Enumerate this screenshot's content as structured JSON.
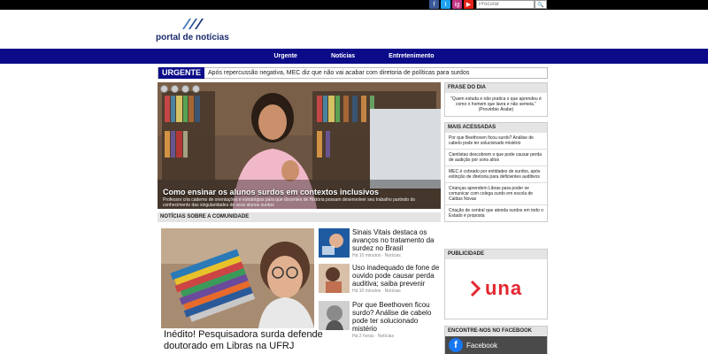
{
  "search": {
    "placeholder": "Procurar",
    "button_label": "🔍"
  },
  "social": [
    "f",
    "t",
    "ig",
    "▶"
  ],
  "brand": {
    "name": "portal de notícias"
  },
  "nav": {
    "items": [
      "Urgente",
      "Notícias",
      "Entretenimento"
    ]
  },
  "ticker": {
    "tag": "URGENTE",
    "text": "Após repercussão negativa, MEC diz que não vai acabar com diretoria de políticas para surdos"
  },
  "hero": {
    "title": "Como ensinar os alunos surdos em contextos inclusivos",
    "subtitle": "Professor cria caderno de orientações e estratégias para que docentes de História possam desenvolver seu trabalho partindo do conhecimento das singularidades de seus alunos surdos"
  },
  "community": {
    "heading": "NOTÍCIAS SOBRE A COMUNIDADE",
    "feature_title": "Inédito! Pesquisadora surda defende doutorado em Libras na UFRJ",
    "items": [
      {
        "title": "Sinais Vitais destaca os avanços no tratamento da surdez no Brasil",
        "meta": "Há 10 minutos · Notícias"
      },
      {
        "title": "Uso inadequado de fone de ouvido pode causar perda auditiva; saiba prevenir",
        "meta": "Há 10 minutos · Notícias"
      },
      {
        "title": "Por que Beethoven ficou surdo? Análise de cabelo pode ter solucionado mistério",
        "meta": "Há 2 horas · Notícias"
      }
    ]
  },
  "sidebar": {
    "quote_head": "FRASE DO DIA",
    "quote": "\"Quem estuda e não pratica o que aprendeu é como o homem que lavra e não semeia.\" (Provérbio Árabe)",
    "most_head": "MAIS ACESSADAS",
    "most": [
      "Por que Beethoven ficou surdo? Análise de cabelo pode ter solucionado mistério",
      "Cientistas descobrem o que pode causar perda de audição por sons altos",
      "MEC é cobrado por entidades de surdos, após extinção de diretoria para deficientes auditivos",
      "Crianças aprendem Libras para poder se comunicar com colega surdo em escola de Caldas Novas",
      "Criação de central que atenda surdos em todo o Estado é proposta"
    ],
    "ad_head": "PUBLICIDADE",
    "ad_brand": "una",
    "fb_head": "ENCONTRE-NOS NO FACEBOOK",
    "fb_label": "Facebook"
  },
  "colors": {
    "navy": "#0b0b8a",
    "ad_red": "#e3262f"
  }
}
